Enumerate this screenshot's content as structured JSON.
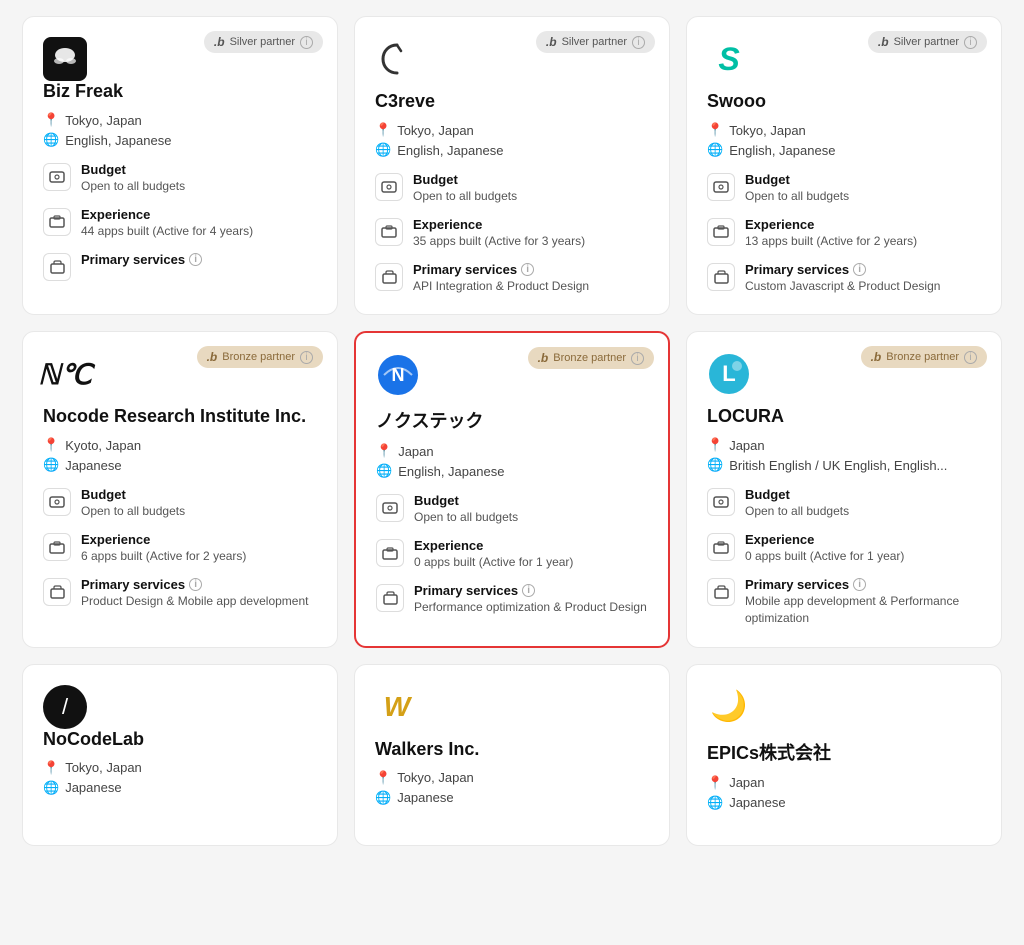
{
  "cards": [
    {
      "id": "bizfreak",
      "partner_type": "silver",
      "partner_label": "Silver partner",
      "company_name": "Biz Freak",
      "location": "Tokyo, Japan",
      "language": "English, Japanese",
      "budget_label": "Budget",
      "budget_value": "Open to all budgets",
      "experience_label": "Experience",
      "experience_value": "44 apps built (Active for 4 years)",
      "primary_services_label": "Primary services",
      "primary_services_value": "",
      "highlighted": false,
      "logo_type": "bizfreak"
    },
    {
      "id": "c3reve",
      "partner_type": "silver",
      "partner_label": "Silver partner",
      "company_name": "C3reve",
      "location": "Tokyo, Japan",
      "language": "English, Japanese",
      "budget_label": "Budget",
      "budget_value": "Open to all budgets",
      "experience_label": "Experience",
      "experience_value": "35 apps built (Active for 3 years)",
      "primary_services_label": "Primary services",
      "primary_services_value": "API Integration & Product Design",
      "highlighted": false,
      "logo_type": "c3reve"
    },
    {
      "id": "swooo",
      "partner_type": "silver",
      "partner_label": "Silver partner",
      "company_name": "Swooo",
      "location": "Tokyo, Japan",
      "language": "English, Japanese",
      "budget_label": "Budget",
      "budget_value": "Open to all budgets",
      "experience_label": "Experience",
      "experience_value": "13 apps built (Active for 2 years)",
      "primary_services_label": "Primary services",
      "primary_services_value": "Custom Javascript & Product Design",
      "highlighted": false,
      "logo_type": "swooo"
    },
    {
      "id": "nocode-research",
      "partner_type": "bronze",
      "partner_label": "Bronze partner",
      "company_name": "Nocode Research Institute Inc.",
      "location": "Kyoto, Japan",
      "language": "Japanese",
      "budget_label": "Budget",
      "budget_value": "Open to all budgets",
      "experience_label": "Experience",
      "experience_value": "6 apps built (Active for 2 years)",
      "primary_services_label": "Primary services",
      "primary_services_value": "Product Design & Mobile app development",
      "highlighted": false,
      "logo_type": "nocode-research"
    },
    {
      "id": "nokustech",
      "partner_type": "bronze",
      "partner_label": "Bronze partner",
      "company_name": "ノクステック",
      "location": "Japan",
      "language": "English, Japanese",
      "budget_label": "Budget",
      "budget_value": "Open to all budgets",
      "experience_label": "Experience",
      "experience_value": "0 apps built (Active for 1 year)",
      "primary_services_label": "Primary services",
      "primary_services_value": "Performance optimization & Product Design",
      "highlighted": true,
      "logo_type": "nokustech"
    },
    {
      "id": "locura",
      "partner_type": "bronze",
      "partner_label": "Bronze partner",
      "company_name": "LOCURA",
      "location": "Japan",
      "language": "British English / UK English, English...",
      "budget_label": "Budget",
      "budget_value": "Open to all budgets",
      "experience_label": "Experience",
      "experience_value": "0 apps built (Active for 1 year)",
      "primary_services_label": "Primary services",
      "primary_services_value": "Mobile app development & Performance optimization",
      "highlighted": false,
      "logo_type": "locura"
    },
    {
      "id": "nocodelab",
      "partner_type": "none",
      "partner_label": "",
      "company_name": "NoCodeLab",
      "location": "Tokyo, Japan",
      "language": "Japanese",
      "budget_label": "",
      "budget_value": "",
      "experience_label": "",
      "experience_value": "",
      "primary_services_label": "",
      "primary_services_value": "",
      "highlighted": false,
      "logo_type": "nocodelab"
    },
    {
      "id": "walkers",
      "partner_type": "none",
      "partner_label": "",
      "company_name": "Walkers Inc.",
      "location": "Tokyo, Japan",
      "language": "Japanese",
      "budget_label": "",
      "budget_value": "",
      "experience_label": "",
      "experience_value": "",
      "primary_services_label": "",
      "primary_services_value": "",
      "highlighted": false,
      "logo_type": "walkers"
    },
    {
      "id": "epics",
      "partner_type": "none",
      "partner_label": "",
      "company_name": "EPICs株式会社",
      "location": "Japan",
      "language": "Japanese",
      "budget_label": "",
      "budget_value": "",
      "experience_label": "",
      "experience_value": "",
      "primary_services_label": "",
      "primary_services_value": "",
      "highlighted": false,
      "logo_type": "epics"
    }
  ]
}
